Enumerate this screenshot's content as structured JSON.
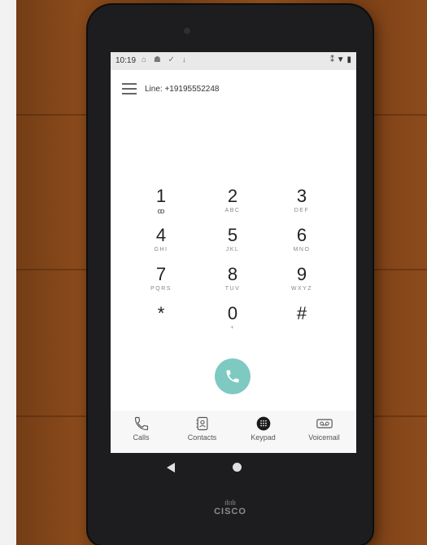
{
  "status_bar": {
    "time": "10:19",
    "left_icons": "⌂ ☗ ✓ ↓",
    "right_icons": "⁑ ▼ ▮"
  },
  "header": {
    "line_text": "Line: +19195552248"
  },
  "keypad": {
    "keys": [
      {
        "digit": "1",
        "letters": "ꝏ"
      },
      {
        "digit": "2",
        "letters": "ABC"
      },
      {
        "digit": "3",
        "letters": "DEF"
      },
      {
        "digit": "4",
        "letters": "GHI"
      },
      {
        "digit": "5",
        "letters": "JKL"
      },
      {
        "digit": "6",
        "letters": "MNO"
      },
      {
        "digit": "7",
        "letters": "PQRS"
      },
      {
        "digit": "8",
        "letters": "TUV"
      },
      {
        "digit": "9",
        "letters": "WXYZ"
      },
      {
        "digit": "*",
        "letters": ""
      },
      {
        "digit": "0",
        "letters": "+"
      },
      {
        "digit": "#",
        "letters": ""
      }
    ]
  },
  "nav": {
    "items": [
      {
        "label": "Calls"
      },
      {
        "label": "Contacts"
      },
      {
        "label": "Keypad"
      },
      {
        "label": "Voicemail"
      }
    ]
  },
  "brand": {
    "name": "CISCO"
  },
  "colors": {
    "call_button": "#7ec9c2",
    "wood": "#8a4a1b",
    "phone_body": "#1d1d1f"
  }
}
